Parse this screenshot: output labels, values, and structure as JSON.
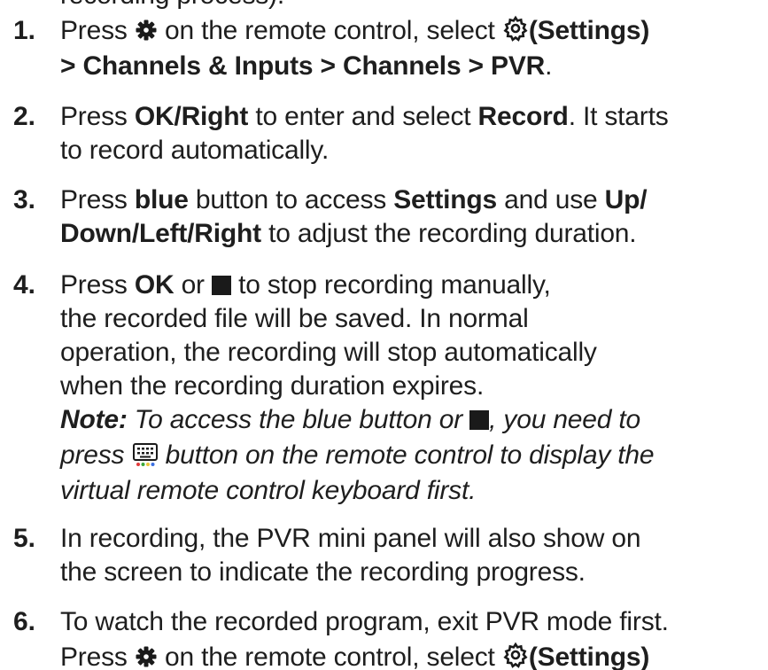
{
  "top_fragment": "recording process).",
  "steps": [
    {
      "number": "1.",
      "lines": [
        {
          "a": "Press ",
          "b": " on the remote control, select ",
          "c": "(Settings)"
        },
        {
          "a": "> Channels & Inputs > Channels > PVR",
          "b": "."
        }
      ]
    },
    {
      "number": "2.",
      "lines": [
        {
          "a": "Press ",
          "b": "OK/Right",
          "c": " to enter and select ",
          "d": "Record",
          "e": ". It starts"
        },
        {
          "a": "to record automatically."
        }
      ]
    },
    {
      "number": "3.",
      "lines": [
        {
          "a": "Press ",
          "b": "blue",
          "c": " button to access ",
          "d": "Settings",
          "e": " and use ",
          "f": "Up/"
        },
        {
          "a": "Down/Left/Right",
          "b": " to adjust the recording duration."
        }
      ]
    },
    {
      "number": "4.",
      "lines": [
        {
          "a": "Press ",
          "b": "OK",
          "c": " or ",
          "d": " to stop recording manually,"
        },
        {
          "a": "the recorded file will be saved. In normal"
        },
        {
          "a": "operation, the recording will stop automatically"
        },
        {
          "a": "when the recording duration expires."
        },
        {
          "a": "Note:",
          "b": " To access the blue button or ",
          "c": ", you need to"
        },
        {
          "a": "press ",
          "b": " button on the remote control to display the"
        },
        {
          "a": "virtual remote control keyboard first."
        }
      ]
    },
    {
      "number": "5.",
      "lines": [
        {
          "a": "In recording, the PVR mini panel will also show on"
        },
        {
          "a": "the screen to indicate the recording progress."
        }
      ]
    },
    {
      "number": "6.",
      "lines": [
        {
          "a": "To watch the recorded program, exit PVR mode first."
        },
        {
          "a": "Press ",
          "b": " on the remote control, select ",
          "c": "(Settings)"
        }
      ]
    }
  ],
  "icons": {
    "menu": "gear-menu-icon",
    "settings": "settings-gear-icon",
    "stop": "stop-square-icon",
    "keyboard": "virtual-keyboard-icon"
  },
  "colors": {
    "text": "#1e1e1e",
    "keyboard_dots": [
      "#e23b3b",
      "#3ba83b",
      "#e8c53a",
      "#3b6fe2"
    ]
  }
}
